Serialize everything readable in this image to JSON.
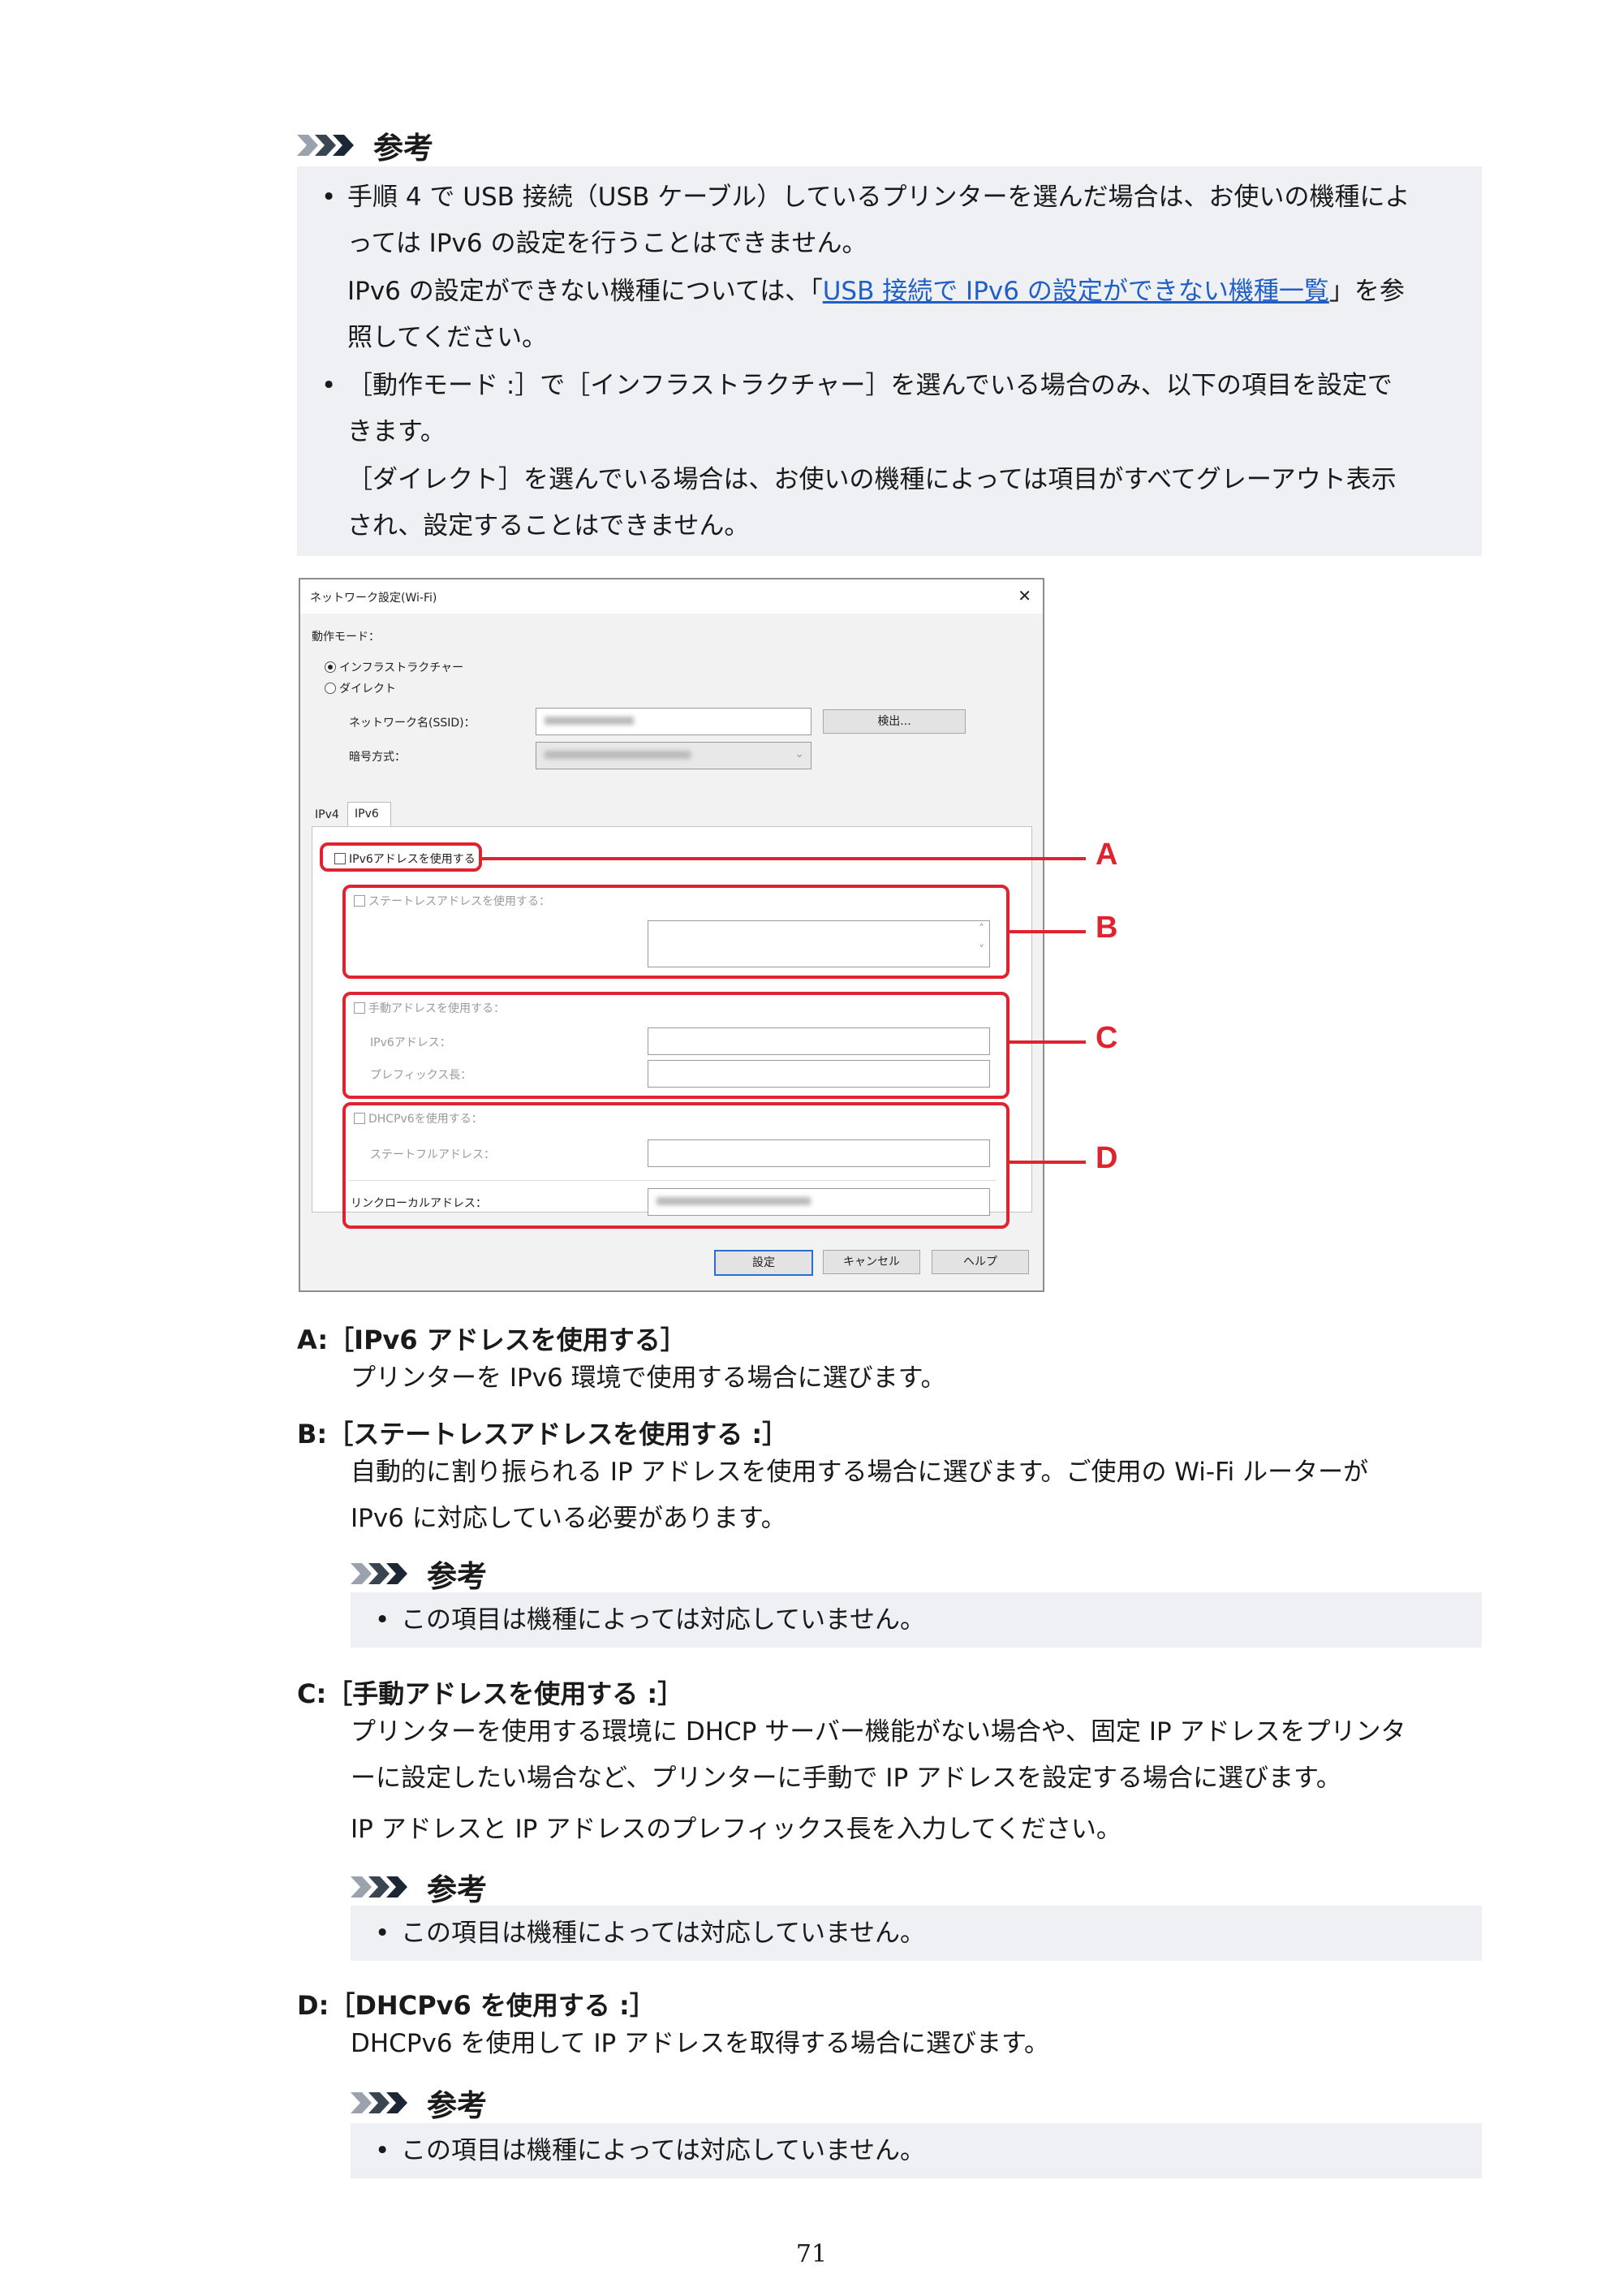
{
  "note_label": "参考",
  "note1": {
    "b1_l1": "手順 4 で USB 接続（USB ケーブル）しているプリンターを選んだ場合は、お使いの機種によ",
    "b1_l2": "っては IPv6 の設定を行うことはできません。",
    "p1_pre": "IPv6 の設定ができない機種については、「",
    "p1_link": "USB 接続で IPv6 の設定ができない機種一覧",
    "p1_post": "」を参",
    "p1_l2": "照してください。",
    "b2_l1": "［動作モード :］で［インフラストラクチャー］を選んでいる場合のみ、以下の項目を設定で",
    "b2_l2": "きます。",
    "p2_l1": "［ダイレクト］を選んでいる場合は、お使いの機種によっては項目がすべてグレーアウト表示",
    "p2_l2": "され、設定することはできません。"
  },
  "dialog": {
    "title": "ネットワーク設定(Wi-Fi)",
    "close": "✕",
    "mode_label": "動作モード：",
    "mode_infra": "インフラストラクチャー",
    "mode_direct": "ダイレクト",
    "ssid_label": "ネットワーク名(SSID)：",
    "detect_button": "検出...",
    "enc_label": "暗号方式：",
    "tab_ipv4": "IPv4",
    "tab_ipv6": "IPv6",
    "use_ipv6": "IPv6アドレスを使用する",
    "stateless": "ステートレスアドレスを使用する：",
    "manual": "手動アドレスを使用する：",
    "ipv6_addr": "IPv6アドレス：",
    "prefix": "プレフィックス長：",
    "dhcpv6": "DHCPv6を使用する：",
    "stateful": "ステートフルアドレス：",
    "link_local": "リンクローカルアドレス：",
    "ok_button": "設定",
    "cancel_button": "キャンセル",
    "help_button": "ヘルプ"
  },
  "callouts": [
    "A",
    "B",
    "C",
    "D"
  ],
  "sections": {
    "a_title": "A:［IPv6 アドレスを使用する］",
    "a_body": "プリンターを IPv6 環境で使用する場合に選びます。",
    "b_title": "B:［ステートレスアドレスを使用する :］",
    "b_body1": "自動的に割り振られる IP アドレスを使用する場合に選びます。ご使用の Wi-Fi ルーターが",
    "b_body2": "IPv6 に対応している必要があります。",
    "b_note": "この項目は機種によっては対応していません。",
    "c_title": "C:［手動アドレスを使用する :］",
    "c_body1": "プリンターを使用する環境に DHCP サーバー機能がない場合や、固定 IP アドレスをプリンタ",
    "c_body2": "ーに設定したい場合など、プリンターに手動で IP アドレスを設定する場合に選びます。",
    "c_body3": "IP アドレスと IP アドレスのプレフィックス長を入力してください。",
    "c_note": "この項目は機種によっては対応していません。",
    "d_title": "D:［DHCPv6 を使用する :］",
    "d_body": "DHCPv6 を使用して IP アドレスを取得する場合に選びます。",
    "d_note": "この項目は機種によっては対応していません。"
  },
  "page_number": "71",
  "colors": {
    "accent_red": "#e0242f",
    "link_blue": "#1f5fc7",
    "note_bg": "#eef0f3"
  }
}
